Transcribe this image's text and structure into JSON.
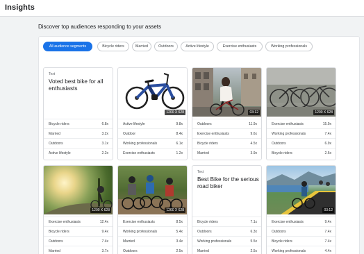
{
  "header": {
    "title": "Insights"
  },
  "section": {
    "title": "Discover top audiences responding to your assets"
  },
  "chips": [
    {
      "label": "All audience segments",
      "active": true
    },
    {
      "label": "Bicycle riders",
      "active": false
    },
    {
      "label": "Married",
      "active": false
    },
    {
      "label": "Outdoors",
      "active": false
    },
    {
      "label": "Active lifestyle",
      "active": false
    },
    {
      "label": "Exercise enthusiasts",
      "active": false
    },
    {
      "label": "Working professionals",
      "active": false
    }
  ],
  "cards": [
    {
      "kind": "text",
      "type_label": "Text",
      "headline": "Voted best bike for all enthusiasts",
      "metrics": [
        {
          "label": "Bicycle riders",
          "value": "6.8x"
        },
        {
          "label": "Married",
          "value": "3.2x"
        },
        {
          "label": "Outdoors",
          "value": "3.1x"
        },
        {
          "label": "Active lifestyle",
          "value": "2.2x"
        }
      ]
    },
    {
      "kind": "image",
      "image": "blue-ebike-photo",
      "badge": "1200 X 628",
      "metrics": [
        {
          "label": "Active lifestyle",
          "value": "9.8x"
        },
        {
          "label": "Outdoor",
          "value": "8.4x"
        },
        {
          "label": "Working professionals",
          "value": "6.1x"
        },
        {
          "label": "Exercise enthusiasts",
          "value": "1.2x"
        }
      ]
    },
    {
      "kind": "video",
      "image": "woman-riding-bike-city-photo",
      "badge": "03:12",
      "metrics": [
        {
          "label": "Outdoors",
          "value": "11.9x"
        },
        {
          "label": "Exercise enthusiasts",
          "value": "9.6x"
        },
        {
          "label": "Bicycle riders",
          "value": "4.5x"
        },
        {
          "label": "Married",
          "value": "3.9x"
        }
      ]
    },
    {
      "kind": "image",
      "image": "parked-bikes-street-photo",
      "badge": "1200 X 628",
      "metrics": [
        {
          "label": "Exercise enthusiasts",
          "value": "15.9x"
        },
        {
          "label": "Working professionals",
          "value": "7.4x"
        },
        {
          "label": "Outdoors",
          "value": "6.9x"
        },
        {
          "label": "Bicycle riders",
          "value": "2.5x"
        }
      ]
    },
    {
      "kind": "image",
      "image": "sunset-trail-cyclist-photo",
      "badge": "1200 X 628",
      "metrics": [
        {
          "label": "Exercise enthusiasts",
          "value": "12.4x"
        },
        {
          "label": "Bicycle riders",
          "value": "9.4x"
        },
        {
          "label": "Outdoors",
          "value": "7.4x"
        },
        {
          "label": "Married",
          "value": "3.7x"
        }
      ]
    },
    {
      "kind": "image",
      "image": "group-mountain-bikers-photo",
      "badge": "1200 X 628",
      "metrics": [
        {
          "label": "Exercise enthusiasts",
          "value": "8.5x"
        },
        {
          "label": "Working professionals",
          "value": "5.4x"
        },
        {
          "label": "Married",
          "value": "3.4x"
        },
        {
          "label": "Outdoors",
          "value": "2.5x"
        }
      ]
    },
    {
      "kind": "text",
      "type_label": "Text",
      "headline": "Best Bike for the serious road biker",
      "metrics": [
        {
          "label": "Bicycle riders",
          "value": "7.1x"
        },
        {
          "label": "Outdoors",
          "value": "6.3x"
        },
        {
          "label": "Working professionals",
          "value": "5.5x"
        },
        {
          "label": "Married",
          "value": "2.5x"
        }
      ]
    },
    {
      "kind": "video",
      "image": "lakeside-road-cyclists-photo",
      "badge": "03:12",
      "metrics": [
        {
          "label": "Exercise enthusiasts",
          "value": "9.4x"
        },
        {
          "label": "Outdoors",
          "value": "7.4x"
        },
        {
          "label": "Bicycle riders",
          "value": "7.4x"
        },
        {
          "label": "Working professionals",
          "value": "4.4x"
        }
      ]
    }
  ]
}
